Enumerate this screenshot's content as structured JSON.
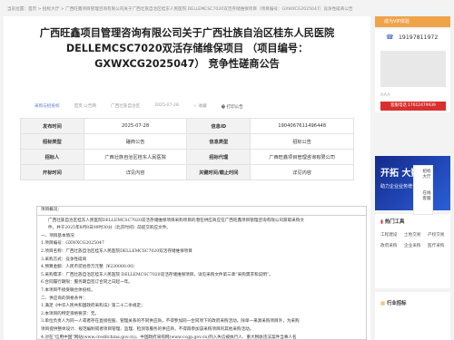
{
  "breadcrumb": "当前位置：首页 > 招标大厅 > 广西旺鑫项目管理咨询有限公司关于广西壮族自治区桂东人民医院 DELLEMCSC7020双活存储维保项目（项目编号：GXWXCG2025047）竞争性磋商公告",
  "title_lines": [
    "广西旺鑫项目管理咨询有限公司关于广西壮族自治区桂东人民医院",
    "DELLEMCSC7020双活存储维保项目 （项目编号：",
    "GXWXCG2025047） 竞争性磋商公告"
  ],
  "meta": {
    "source_label": "采购与招投标",
    "platform": "首页·公告网",
    "region": "广西壮族自治区",
    "date": "2025-07-28",
    "collect_label": "收藏",
    "print_label": "打印公告"
  },
  "info_table": [
    {
      "k1": "发布时间",
      "v1": "2025-07-28",
      "k2": "信息ID",
      "v2": "1904067611496448"
    },
    {
      "k1": "招标类型",
      "v1": "磋商公告",
      "k2": "信息类型",
      "v2": "招标公告"
    },
    {
      "k1": "招标人",
      "v1": "广西壮族自治区桂东人民医院",
      "k2": "招标代理",
      "v2": "广西旺鑫项目管理咨询有限公司"
    },
    {
      "k1": "开标时间",
      "v1": "详见内容",
      "k2": "关键时间/截止时间",
      "v2": "详见内容"
    }
  ],
  "notice": {
    "heading": "项目概况：",
    "lines": [
      "广西壮族自治区桂东人民医院DELLEMCSC7020双活存储维保项目采购项目的潜在供应商应在广西旺鑫项目管理咨询有限公司获取采购文",
      "件，并于2025年8月8日09时30分（北京时间）前提交响应文件。",
      "一、项目基本情况",
      "1.项目编号：GXWXCG2025047",
      "2.项目名称：广西壮族自治区桂东人民医院DELLEMCSC7020双活存储维保项目",
      "3.采购方式：竞争性磋商",
      "4.预算金额：人民币贰拾叁万元整（¥230000.00）",
      "5.采购需求：广西壮族自治区桂东人民医院 DELLEMCSC7020双活存储维保项目，详见采购文件第三章“采购需求和说明”。",
      "6.合同履行期限：服务期自签订合同之日起一年。",
      "7.本项目不接受联合体投标。",
      "二、供应商的资格条件：",
      "1.满足《中华人民共和国政府采购法》第二十二条规定；",
      "2.本项目的特定资格要求：无。",
      "3.单位负责人为同一人或者存在直接控股、管理关系的不同供应商，不得参加同一合同项下的政府采购活动。除单一来源采购项目外，为采购",
      "项目提供整体设计、规范编制或者项目管理、监理、检测等服务的供应商，不得再参加该采购项目的其他采购活动。",
      "4.对在“信用中国”网站(www.creditchina.gov.cn)、中国政府采购网(www.ccgp.gov.cn)列入失信被执行人、重大税收违法案件当事人名"
    ]
  },
  "sidebar": {
    "version_label": "成为VIP体验",
    "phone": "19197811972",
    "aaa": "AAA",
    "red_banner": "客服电话 17612479939",
    "banner_text1": "开拓 大数据",
    "banner_text2": "助力企业业务增长",
    "tools_title": "热门工具",
    "tools": [
      "工程建设",
      "土地交易",
      "产权交易",
      "政府采购",
      "企业采购",
      "医疗采购"
    ],
    "industry_title": "行业招标"
  },
  "float_nav": [
    "招标",
    "大厅",
    "在线",
    "客服"
  ],
  "colors": {
    "accent": "#f0a34b",
    "red": "#d9302f",
    "banner": "#2b5fd9"
  }
}
